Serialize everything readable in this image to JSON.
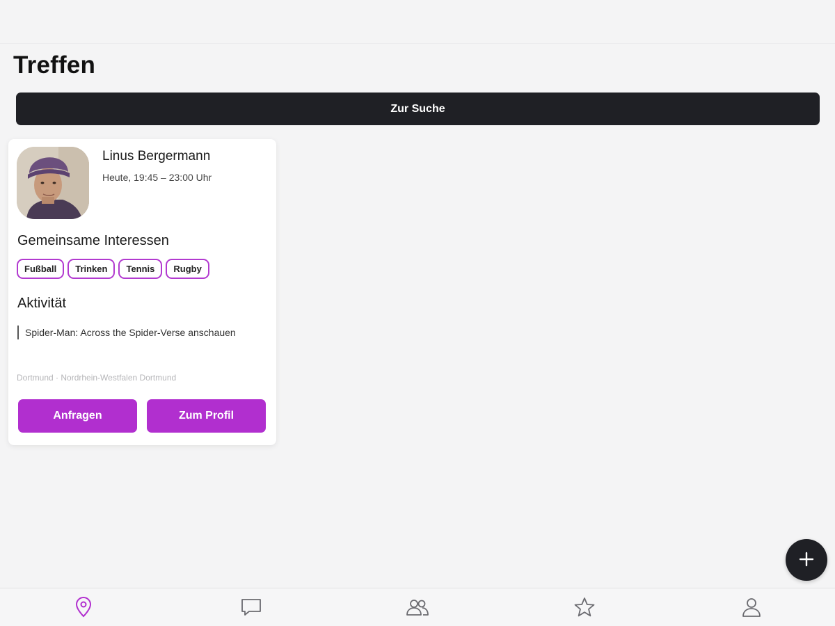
{
  "page": {
    "title": "Treffen",
    "search_button_label": "Zur Suche"
  },
  "meet_card": {
    "name": "Linus Bergermann",
    "time": "Heute, 19:45 – 23:00 Uhr",
    "interests_heading": "Gemeinsame Interessen",
    "interests": [
      "Fußball",
      "Trinken",
      "Tennis",
      "Rugby"
    ],
    "activity_heading": "Aktivität",
    "activity_text": "Spider-Man: Across the Spider-Verse anschauen",
    "location": "Dortmund · Nordrhein-Westfalen Dortmund",
    "request_button_label": "Anfragen",
    "profile_button_label": "Zum Profil"
  },
  "fab": {
    "icon": "plus-icon"
  },
  "tabbar": {
    "active_tab": "meet",
    "tabs": [
      {
        "id": "meet",
        "icon": "map-pin-icon"
      },
      {
        "id": "chat",
        "icon": "chat-bubble-icon"
      },
      {
        "id": "friends",
        "icon": "people-icon"
      },
      {
        "id": "favorites",
        "icon": "star-icon"
      },
      {
        "id": "profile",
        "icon": "person-icon"
      }
    ]
  },
  "colors": {
    "accent": "#b12fcf",
    "dark": "#1f2025",
    "background": "#f4f4f5",
    "inactive_icon": "#6b6b70"
  }
}
